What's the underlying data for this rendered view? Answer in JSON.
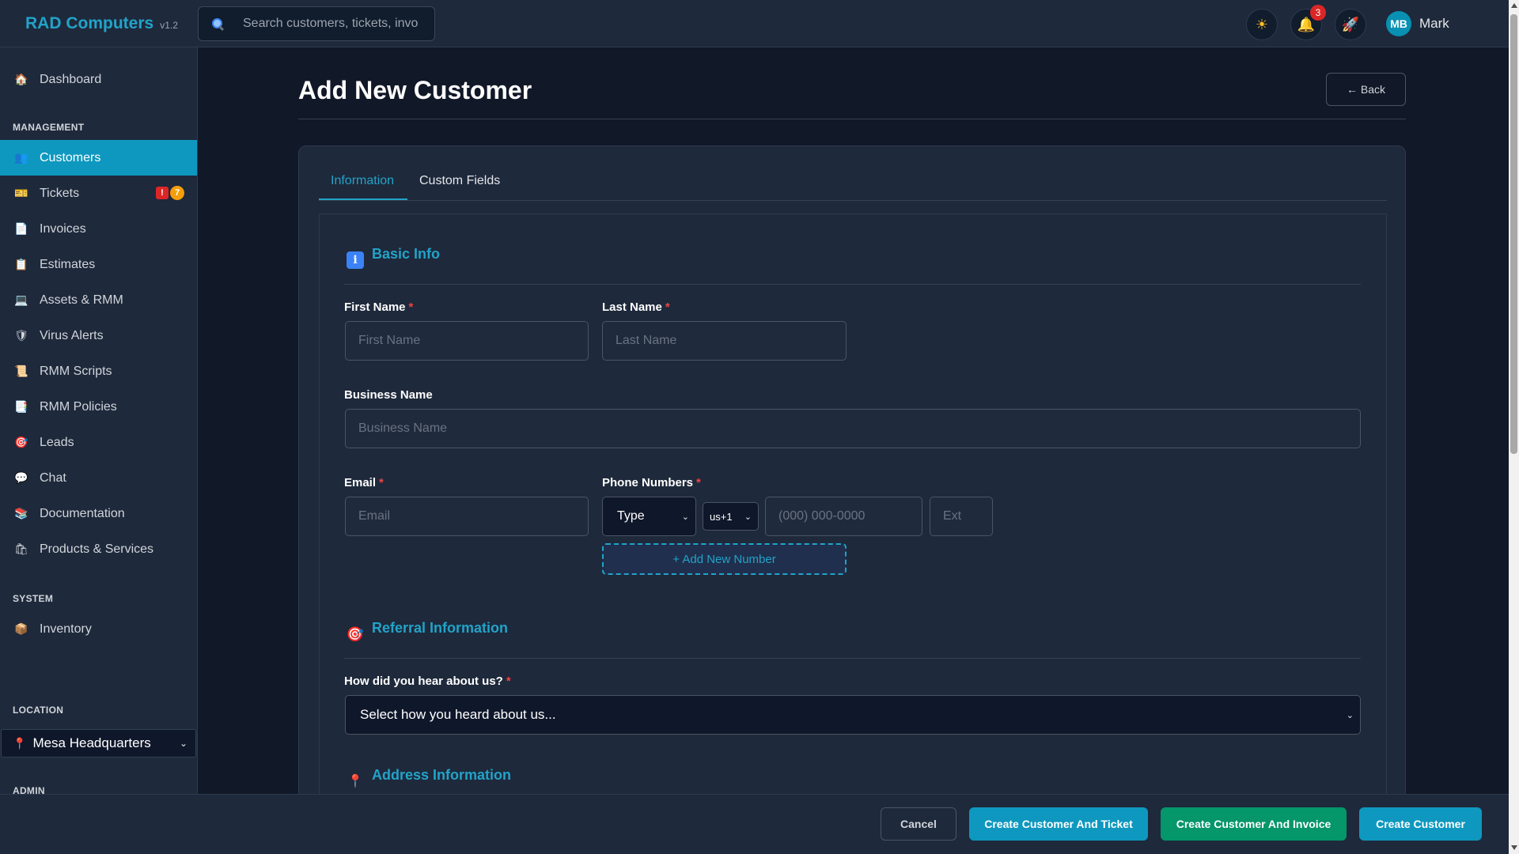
{
  "app": {
    "name": "RAD Computers",
    "version": "v1.2"
  },
  "search": {
    "placeholder": "Search customers, tickets, invo"
  },
  "topbar": {
    "notifications_count": "3",
    "user_initials": "MB",
    "user_name": "Mark"
  },
  "sidebar": {
    "dashboard": "Dashboard",
    "management_title": "MANAGEMENT",
    "items": [
      {
        "label": "Customers",
        "icon": "people-icon"
      },
      {
        "label": "Tickets",
        "icon": "ticket-icon"
      },
      {
        "label": "Invoices",
        "icon": "document-icon"
      },
      {
        "label": "Estimates",
        "icon": "clipboard-icon"
      },
      {
        "label": "Assets & RMM",
        "icon": "laptop-icon"
      },
      {
        "label": "Virus Alerts",
        "icon": "shield-icon"
      },
      {
        "label": "RMM Scripts",
        "icon": "scroll-icon"
      },
      {
        "label": "RMM Policies",
        "icon": "policy-icon"
      },
      {
        "label": "Leads",
        "icon": "target-icon"
      },
      {
        "label": "Chat",
        "icon": "chat-bubble-icon"
      },
      {
        "label": "Documentation",
        "icon": "books-icon"
      },
      {
        "label": "Products & Services",
        "icon": "shopping-bags-icon"
      }
    ],
    "tickets_alert": "!",
    "tickets_count": "7",
    "system_title": "SYSTEM",
    "inventory": "Inventory",
    "location_title": "LOCATION",
    "location_value": "Mesa Headquarters",
    "admin_title": "ADMIN"
  },
  "page": {
    "title": "Add New Customer",
    "back_label": "← Back"
  },
  "tabs": [
    "Information",
    "Custom Fields"
  ],
  "form": {
    "basic_info_title": "Basic Info",
    "first_name_label": "First Name",
    "first_name_placeholder": "First Name",
    "last_name_label": "Last Name",
    "last_name_placeholder": "Last Name",
    "business_name_label": "Business Name",
    "business_name_placeholder": "Business Name",
    "email_label": "Email",
    "email_placeholder": "Email",
    "phone_label": "Phone Numbers",
    "phone_type": "Type",
    "phone_country": "us+1",
    "phone_placeholder": "(000) 000-0000",
    "ext_placeholder": "Ext",
    "add_number": "+ Add New Number",
    "required_mark": "*",
    "referral_title": "Referral Information",
    "referral_label": "How did you hear about us?",
    "referral_value": "Select how you heard about us...",
    "address_title": "Address Information"
  },
  "footer": {
    "cancel": "Cancel",
    "create_ticket": "Create Customer And Ticket",
    "create_invoice": "Create Customer And Invoice",
    "create": "Create Customer"
  },
  "colors": {
    "accent": "#0e98bf",
    "invoice_green": "#059669",
    "required": "#ef4444",
    "background": "#111827",
    "panel": "#1e293b"
  }
}
